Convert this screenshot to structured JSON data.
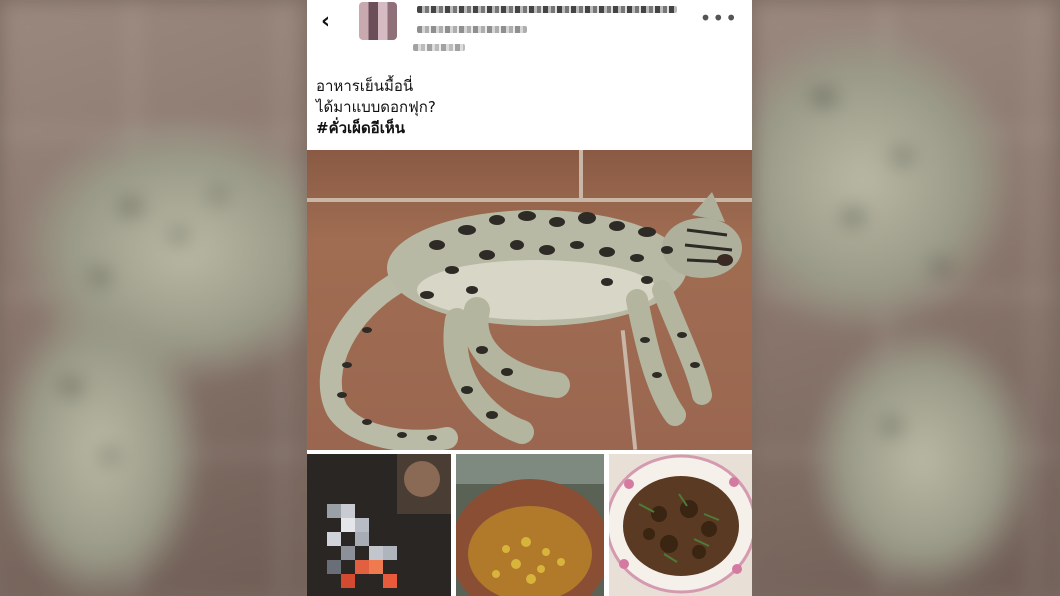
{
  "post": {
    "back_icon": "chevron-left-icon",
    "more_icon": "more-horizontal-icon",
    "author_name_pixelated": true,
    "text_line_1": "อาหารเย็นมื้อนี่",
    "text_line_2": "ได้มาแบบดอกฟุก?",
    "hashtag": "#คั่วเผ็ดอีเห็น"
  },
  "colors": {
    "post_background": "#ffffff",
    "text": "#111111",
    "floor": "#a06d52"
  },
  "photos": {
    "main": "leopard-cat-lying-on-tiled-floor",
    "thumb_1": "pixelated-animal-over-fire",
    "thumb_2": "clay-pot-with-curry",
    "thumb_3": "stir-fried-meat-on-floral-plate"
  }
}
